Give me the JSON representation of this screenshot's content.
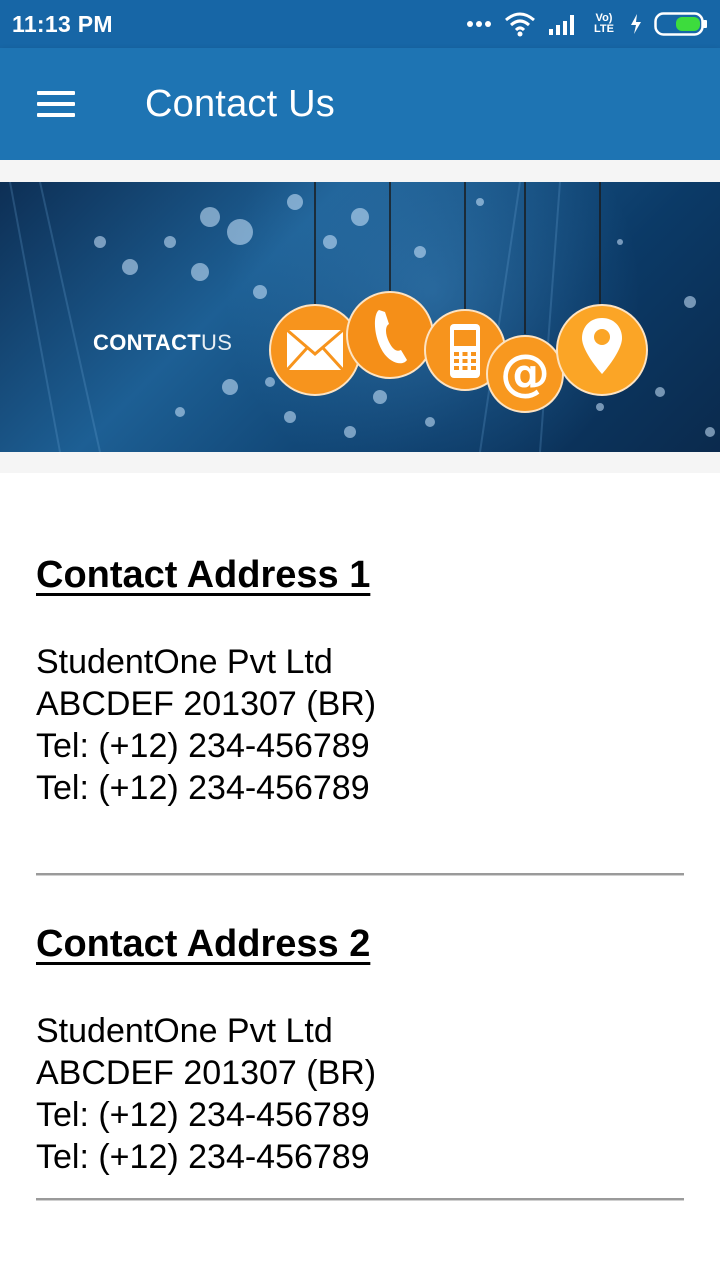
{
  "status_bar": {
    "time": "11:13 PM",
    "network_label": "Vo) LTE",
    "icons": [
      "more-dots-icon",
      "wifi-icon",
      "signal-icon",
      "volte-icon",
      "charging-icon",
      "battery-icon"
    ]
  },
  "app_bar": {
    "title": "Contact Us",
    "menu_icon": "hamburger-menu-icon",
    "color": "#1e74b3"
  },
  "banner": {
    "text_bold": "CONTACT",
    "text_light": "US",
    "icons": [
      "envelope-icon",
      "phone-icon",
      "mobile-icon",
      "at-icon",
      "location-pin-icon"
    ],
    "accent": "#f7941d"
  },
  "contacts": [
    {
      "title": "Contact Address 1",
      "lines": [
        "StudentOne Pvt Ltd",
        "ABCDEF 201307 (BR)",
        "Tel: (+12) 234-456789",
        "Tel: (+12) 234-456789"
      ]
    },
    {
      "title": "Contact Address 2",
      "lines": [
        "StudentOne Pvt Ltd",
        "ABCDEF 201307 (BR)",
        "Tel: (+12) 234-456789",
        "Tel: (+12) 234-456789"
      ]
    }
  ]
}
